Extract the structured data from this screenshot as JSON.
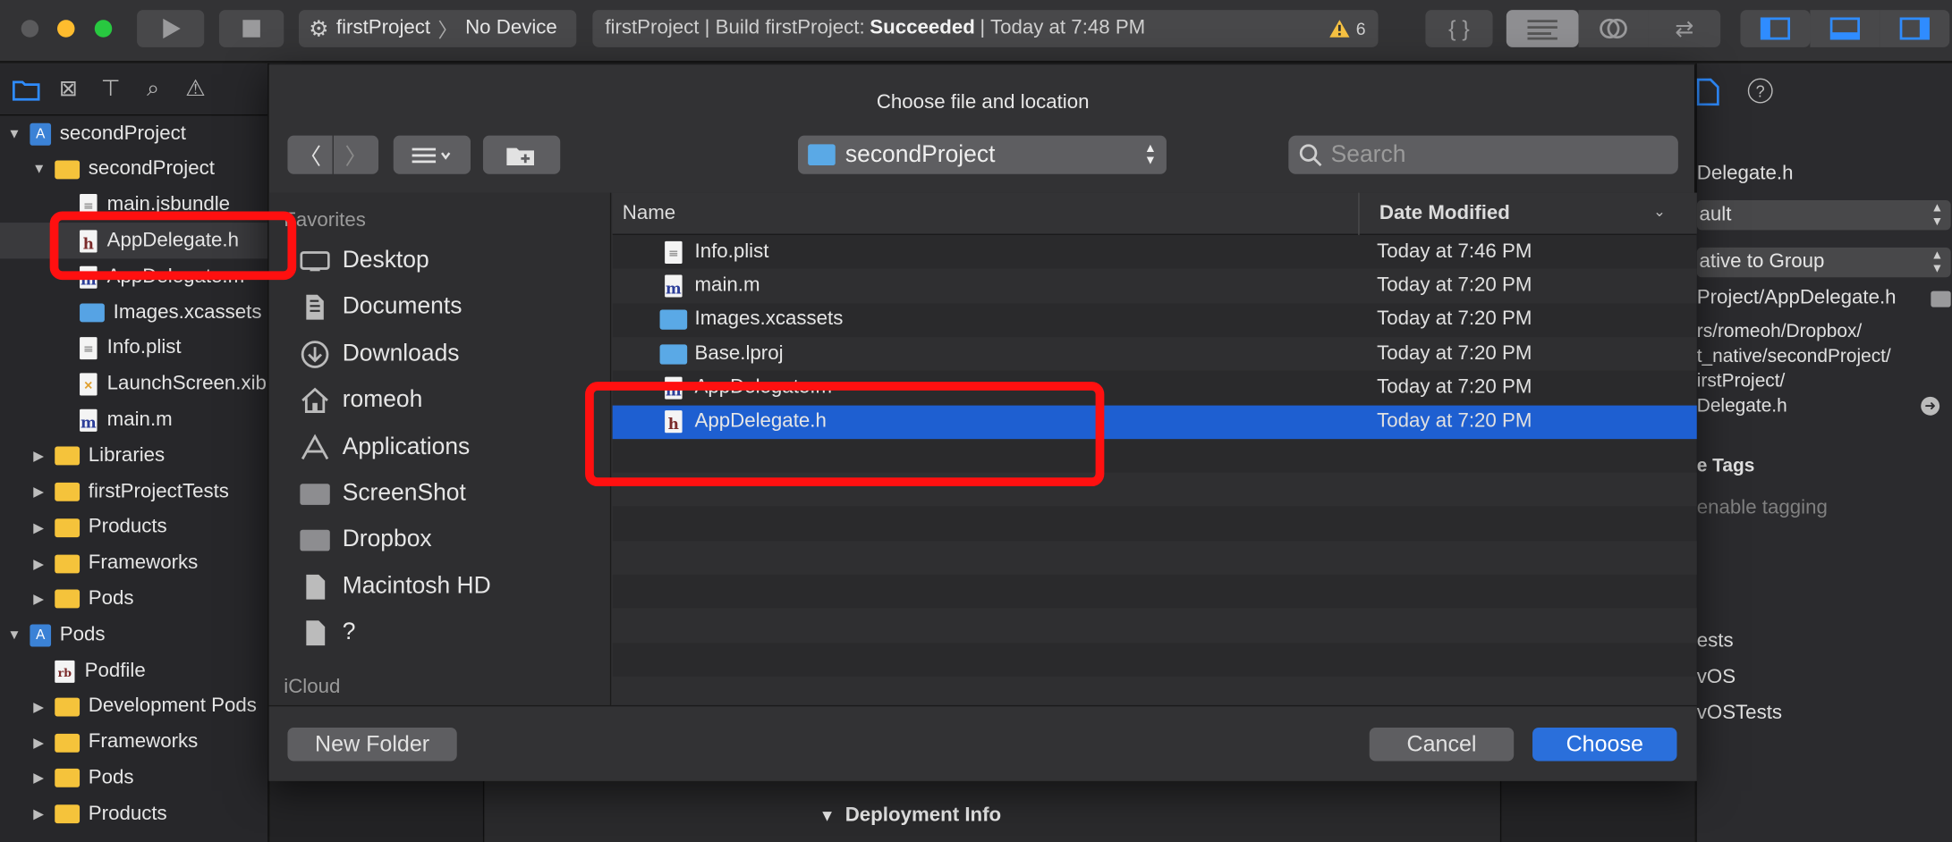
{
  "toolbar": {
    "scheme_project": "firstProject",
    "scheme_device": "No Device",
    "activity_prefix": "firstProject | Build firstProject:",
    "activity_status": "Succeeded",
    "activity_time": "| Today at 7:48 PM",
    "warning_count": "6"
  },
  "navigator": {
    "items": [
      {
        "label": "secondProject",
        "kind": "project",
        "expanded": true
      },
      {
        "label": "secondProject",
        "kind": "folder",
        "expanded": true
      },
      {
        "label": "main.jsbundle",
        "kind": "file"
      },
      {
        "label": "AppDelegate.h",
        "kind": "h"
      },
      {
        "label": "AppDelegate.m",
        "kind": "m"
      },
      {
        "label": "Images.xcassets",
        "kind": "folder-blue"
      },
      {
        "label": "Info.plist",
        "kind": "plist"
      },
      {
        "label": "LaunchScreen.xib",
        "kind": "xib"
      },
      {
        "label": "main.m",
        "kind": "m"
      },
      {
        "label": "Libraries",
        "kind": "folder"
      },
      {
        "label": "firstProjectTests",
        "kind": "folder"
      },
      {
        "label": "Products",
        "kind": "folder"
      },
      {
        "label": "Frameworks",
        "kind": "folder"
      },
      {
        "label": "Pods",
        "kind": "folder"
      },
      {
        "label": "Pods",
        "kind": "project",
        "expanded": true
      },
      {
        "label": "Podfile",
        "kind": "rb"
      },
      {
        "label": "Development Pods",
        "kind": "folder"
      },
      {
        "label": "Frameworks",
        "kind": "folder"
      },
      {
        "label": "Pods",
        "kind": "folder"
      },
      {
        "label": "Products",
        "kind": "folder"
      }
    ]
  },
  "inspector": {
    "name": "Delegate.h",
    "type": "ault",
    "location": "ative to Group",
    "path1": "Project/AppDelegate.h",
    "full1": "rs/romeoh/Dropbox/",
    "full2": "t_native/secondProject/",
    "full3": "irstProject/",
    "full4": "Delegate.h",
    "tags_title": "e Tags",
    "tags_placeholder": "enable tagging",
    "targets": [
      "ests",
      "vOS",
      "vOSTests"
    ]
  },
  "editor": {
    "deployment_label": "Deployment Info"
  },
  "dialog": {
    "title": "Choose file and location",
    "location": "secondProject",
    "search_placeholder": "Search",
    "favorites_label": "Favorites",
    "icloud_label": "iCloud",
    "sidebar": [
      {
        "label": "Desktop",
        "icon": "desktop-icon"
      },
      {
        "label": "Documents",
        "icon": "documents-icon"
      },
      {
        "label": "Downloads",
        "icon": "downloads-icon"
      },
      {
        "label": "romeoh",
        "icon": "home-icon"
      },
      {
        "label": "Applications",
        "icon": "applications-icon"
      },
      {
        "label": "ScreenShot",
        "icon": "folder-icon"
      },
      {
        "label": "Dropbox",
        "icon": "folder-icon"
      },
      {
        "label": "Macintosh HD",
        "icon": "disk-icon"
      },
      {
        "label": "?",
        "icon": "document-icon"
      }
    ],
    "columns": {
      "name": "Name",
      "date": "Date Modified"
    },
    "files": [
      {
        "name": "Info.plist",
        "date": "Today at 7:46 PM",
        "kind": "plist"
      },
      {
        "name": "main.m",
        "date": "Today at 7:20 PM",
        "kind": "m"
      },
      {
        "name": "Images.xcassets",
        "date": "Today at 7:20 PM",
        "kind": "folder"
      },
      {
        "name": "Base.lproj",
        "date": "Today at 7:20 PM",
        "kind": "folder"
      },
      {
        "name": "AppDelegate.m",
        "date": "Today at 7:20 PM",
        "kind": "m"
      },
      {
        "name": "AppDelegate.h",
        "date": "Today at 7:20 PM",
        "kind": "h",
        "selected": true
      }
    ],
    "new_folder": "New Folder",
    "cancel": "Cancel",
    "choose": "Choose"
  },
  "colors": {
    "accent": "#1e5fd1",
    "primary_button": "#2a6fdb",
    "highlight": "#ff1010"
  }
}
